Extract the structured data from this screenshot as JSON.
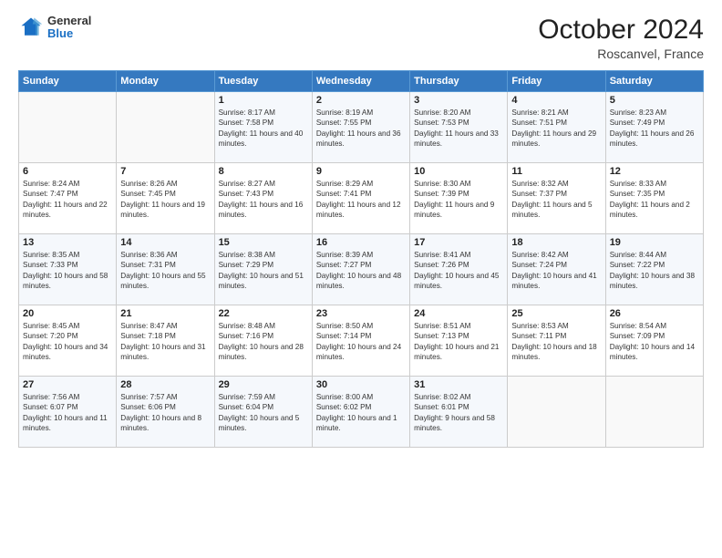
{
  "logo": {
    "general": "General",
    "blue": "Blue"
  },
  "header": {
    "month": "October 2024",
    "location": "Roscanvel, France"
  },
  "weekdays": [
    "Sunday",
    "Monday",
    "Tuesday",
    "Wednesday",
    "Thursday",
    "Friday",
    "Saturday"
  ],
  "weeks": [
    [
      {
        "day": "",
        "content": ""
      },
      {
        "day": "",
        "content": ""
      },
      {
        "day": "1",
        "content": "Sunrise: 8:17 AM\nSunset: 7:58 PM\nDaylight: 11 hours and 40 minutes."
      },
      {
        "day": "2",
        "content": "Sunrise: 8:19 AM\nSunset: 7:55 PM\nDaylight: 11 hours and 36 minutes."
      },
      {
        "day": "3",
        "content": "Sunrise: 8:20 AM\nSunset: 7:53 PM\nDaylight: 11 hours and 33 minutes."
      },
      {
        "day": "4",
        "content": "Sunrise: 8:21 AM\nSunset: 7:51 PM\nDaylight: 11 hours and 29 minutes."
      },
      {
        "day": "5",
        "content": "Sunrise: 8:23 AM\nSunset: 7:49 PM\nDaylight: 11 hours and 26 minutes."
      }
    ],
    [
      {
        "day": "6",
        "content": "Sunrise: 8:24 AM\nSunset: 7:47 PM\nDaylight: 11 hours and 22 minutes."
      },
      {
        "day": "7",
        "content": "Sunrise: 8:26 AM\nSunset: 7:45 PM\nDaylight: 11 hours and 19 minutes."
      },
      {
        "day": "8",
        "content": "Sunrise: 8:27 AM\nSunset: 7:43 PM\nDaylight: 11 hours and 16 minutes."
      },
      {
        "day": "9",
        "content": "Sunrise: 8:29 AM\nSunset: 7:41 PM\nDaylight: 11 hours and 12 minutes."
      },
      {
        "day": "10",
        "content": "Sunrise: 8:30 AM\nSunset: 7:39 PM\nDaylight: 11 hours and 9 minutes."
      },
      {
        "day": "11",
        "content": "Sunrise: 8:32 AM\nSunset: 7:37 PM\nDaylight: 11 hours and 5 minutes."
      },
      {
        "day": "12",
        "content": "Sunrise: 8:33 AM\nSunset: 7:35 PM\nDaylight: 11 hours and 2 minutes."
      }
    ],
    [
      {
        "day": "13",
        "content": "Sunrise: 8:35 AM\nSunset: 7:33 PM\nDaylight: 10 hours and 58 minutes."
      },
      {
        "day": "14",
        "content": "Sunrise: 8:36 AM\nSunset: 7:31 PM\nDaylight: 10 hours and 55 minutes."
      },
      {
        "day": "15",
        "content": "Sunrise: 8:38 AM\nSunset: 7:29 PM\nDaylight: 10 hours and 51 minutes."
      },
      {
        "day": "16",
        "content": "Sunrise: 8:39 AM\nSunset: 7:27 PM\nDaylight: 10 hours and 48 minutes."
      },
      {
        "day": "17",
        "content": "Sunrise: 8:41 AM\nSunset: 7:26 PM\nDaylight: 10 hours and 45 minutes."
      },
      {
        "day": "18",
        "content": "Sunrise: 8:42 AM\nSunset: 7:24 PM\nDaylight: 10 hours and 41 minutes."
      },
      {
        "day": "19",
        "content": "Sunrise: 8:44 AM\nSunset: 7:22 PM\nDaylight: 10 hours and 38 minutes."
      }
    ],
    [
      {
        "day": "20",
        "content": "Sunrise: 8:45 AM\nSunset: 7:20 PM\nDaylight: 10 hours and 34 minutes."
      },
      {
        "day": "21",
        "content": "Sunrise: 8:47 AM\nSunset: 7:18 PM\nDaylight: 10 hours and 31 minutes."
      },
      {
        "day": "22",
        "content": "Sunrise: 8:48 AM\nSunset: 7:16 PM\nDaylight: 10 hours and 28 minutes."
      },
      {
        "day": "23",
        "content": "Sunrise: 8:50 AM\nSunset: 7:14 PM\nDaylight: 10 hours and 24 minutes."
      },
      {
        "day": "24",
        "content": "Sunrise: 8:51 AM\nSunset: 7:13 PM\nDaylight: 10 hours and 21 minutes."
      },
      {
        "day": "25",
        "content": "Sunrise: 8:53 AM\nSunset: 7:11 PM\nDaylight: 10 hours and 18 minutes."
      },
      {
        "day": "26",
        "content": "Sunrise: 8:54 AM\nSunset: 7:09 PM\nDaylight: 10 hours and 14 minutes."
      }
    ],
    [
      {
        "day": "27",
        "content": "Sunrise: 7:56 AM\nSunset: 6:07 PM\nDaylight: 10 hours and 11 minutes."
      },
      {
        "day": "28",
        "content": "Sunrise: 7:57 AM\nSunset: 6:06 PM\nDaylight: 10 hours and 8 minutes."
      },
      {
        "day": "29",
        "content": "Sunrise: 7:59 AM\nSunset: 6:04 PM\nDaylight: 10 hours and 5 minutes."
      },
      {
        "day": "30",
        "content": "Sunrise: 8:00 AM\nSunset: 6:02 PM\nDaylight: 10 hours and 1 minute."
      },
      {
        "day": "31",
        "content": "Sunrise: 8:02 AM\nSunset: 6:01 PM\nDaylight: 9 hours and 58 minutes."
      },
      {
        "day": "",
        "content": ""
      },
      {
        "day": "",
        "content": ""
      }
    ]
  ]
}
